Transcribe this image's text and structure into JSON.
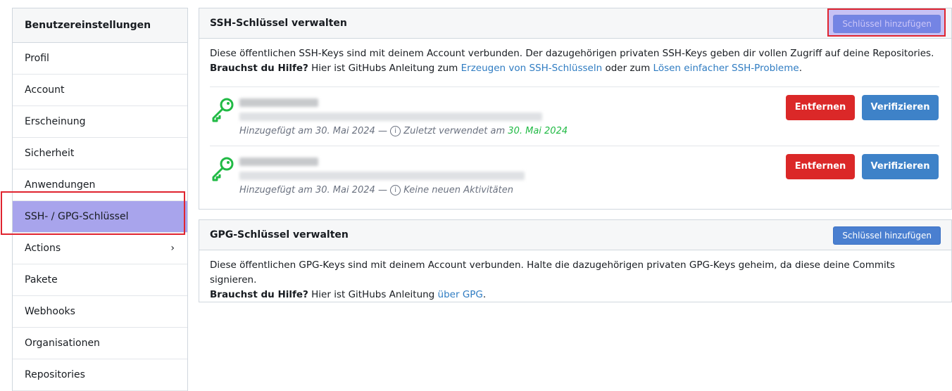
{
  "sidebar": {
    "title": "Benutzereinstellungen",
    "items": [
      {
        "label": "Profil"
      },
      {
        "label": "Account"
      },
      {
        "label": "Erscheinung"
      },
      {
        "label": "Sicherheit"
      },
      {
        "label": "Anwendungen"
      },
      {
        "label": "SSH- / GPG-Schlüssel"
      },
      {
        "label": "Actions",
        "chevron": "›"
      },
      {
        "label": "Pakete"
      },
      {
        "label": "Webhooks"
      },
      {
        "label": "Organisationen"
      },
      {
        "label": "Repositories"
      }
    ]
  },
  "ssh": {
    "title": "SSH-Schlüssel verwalten",
    "add_label": "Schlüssel hinzufügen",
    "desc1": "Diese öffentlichen SSH-Keys sind mit deinem Account verbunden. Der dazugehörigen privaten SSH-Keys geben dir vollen Zugriff auf deine Repositories.",
    "help_bold": "Brauchst du Hilfe?",
    "help_pre": " Hier ist GitHubs Anleitung zum ",
    "help_link1": "Erzeugen von SSH-Schlüsseln",
    "help_mid": " oder zum ",
    "help_link2": "Lösen einfacher SSH-Probleme",
    "help_end": ".",
    "keys": [
      {
        "added": "Hinzugefügt am 30. Mai 2024 —",
        "activity_pre": "Zuletzt verwendet am",
        "activity_date": "30. Mai 2024",
        "remove_label": "Entfernen",
        "verify_label": "Verifizieren"
      },
      {
        "added": "Hinzugefügt am 30. Mai 2024 —",
        "activity_pre": "Keine neuen Aktivitäten",
        "activity_date": "",
        "remove_label": "Entfernen",
        "verify_label": "Verifizieren"
      }
    ]
  },
  "gpg": {
    "title": "GPG-Schlüssel verwalten",
    "add_label": "Schlüssel hinzufügen",
    "desc1": "Diese öffentlichen GPG-Keys sind mit deinem Account verbunden. Halte die dazugehörigen privaten GPG-Keys geheim, da diese deine Commits signieren.",
    "help_bold": "Brauchst du Hilfe?",
    "help_pre": " Hier ist GitHubs Anleitung ",
    "help_link": "über GPG",
    "help_end": "."
  },
  "icons": {
    "key": "key-icon",
    "info": "info-icon",
    "chevron": "chevron-right-icon"
  },
  "colors": {
    "key_green": "#21ba45",
    "danger": "#db2828",
    "primary": "#3e82c8",
    "highlight": "#e0242f"
  }
}
